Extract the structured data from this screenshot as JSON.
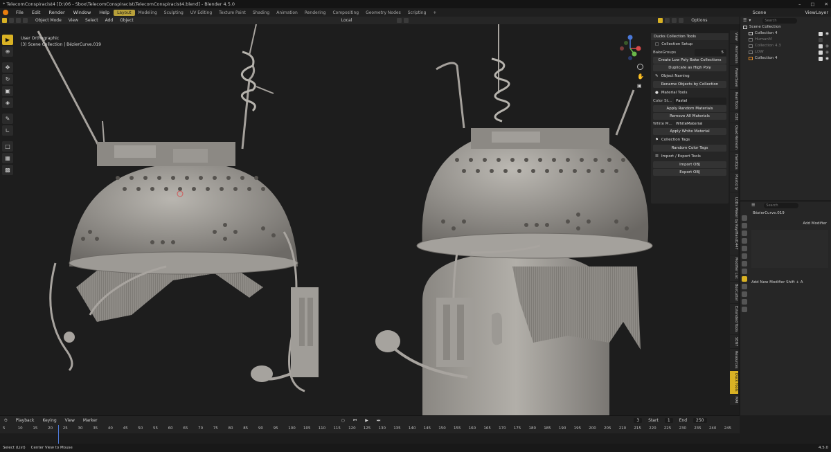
{
  "window": {
    "title": "* TelecomConspiracist4 [D:\\06 - Sbox\\TelecomConspiracist\\TelecomConspiracist4.blend] - Blender 4.5.0"
  },
  "menu": {
    "items": [
      "File",
      "Edit",
      "Render",
      "Window",
      "Help"
    ]
  },
  "workspaces": [
    "Layout",
    "Modeling",
    "Sculpting",
    "UV Editing",
    "Texture Paint",
    "Shading",
    "Animation",
    "Rendering",
    "Compositing",
    "Geometry Nodes",
    "Scripting"
  ],
  "top_right": {
    "scene": "Scene",
    "view_layer": "ViewLayer"
  },
  "viewport_header": {
    "mode": "Object Mode",
    "menus": [
      "View",
      "Select",
      "Add",
      "Object"
    ],
    "transform": "Local",
    "options": "Options"
  },
  "viewport_info": {
    "view": "User Orthographic",
    "context": "(3) Scene Collection | BézierCurve.019"
  },
  "npanel": {
    "title": "Ducks Collection Tools",
    "collection_setup": "Collection Setup",
    "bake_groups_label": "BakeGroups",
    "bake_groups_value": "5",
    "btn_create_low_poly": "Create Low Poly Bake Collections",
    "btn_duplicate": "Duplicate as High Poly",
    "object_naming": "Object Naming",
    "btn_rename": "Rename Objects by Collection",
    "material_tools": "Material Tools",
    "color_style_label": "Color St...",
    "color_style_value": "Pastel",
    "btn_apply_random": "Apply Random Materials",
    "btn_remove_all": "Remove All Materials",
    "white_mat_label": "White M...",
    "white_mat_value": "WhiteMaterial",
    "btn_apply_white": "Apply White Material",
    "collection_tags": "Collection Tags",
    "btn_random_color_tags": "Random Color Tags",
    "import_export": "Import / Export Tools",
    "btn_import_obj": "Import OBJ",
    "btn_export_obj": "Export OBJ"
  },
  "sidebar_tabs": [
    "View",
    "Animation",
    "PowerSave",
    "Real Tools",
    "Edit",
    "Quad Remesh",
    "HardOps",
    "Plasticity",
    "LODs Maker by KaylHand1447",
    "Modifier List",
    "BoxCutter",
    "Extended Tools",
    "SEN7",
    "Resources",
    "Duck Tools",
    "MAI"
  ],
  "outliner": {
    "search_placeholder": "Search",
    "scene_collection": "Scene Collection",
    "rows": [
      {
        "name": "Collection 4",
        "dim": false
      },
      {
        "name": "HumanM",
        "dim": true
      },
      {
        "name": "Collection 4.3",
        "dim": true
      },
      {
        "name": "LOW",
        "dim": true
      },
      {
        "name": "Collection 4",
        "dim": false
      }
    ]
  },
  "properties": {
    "search_placeholder": "Search",
    "object_name": "BézierCurve.019",
    "add_modifier": "Add Modifier",
    "hint": "Add New Modifier Shift + A"
  },
  "timeline": {
    "menus": [
      "Playback",
      "Keying",
      "View",
      "Marker"
    ],
    "current_frame": "3",
    "start_label": "Start",
    "start_value": "1",
    "end_label": "End",
    "end_value": "250",
    "ticks": [
      "5",
      "10",
      "15",
      "20",
      "25",
      "30",
      "35",
      "40",
      "45",
      "50",
      "55",
      "60",
      "65",
      "70",
      "75",
      "80",
      "85",
      "90",
      "95",
      "100",
      "105",
      "110",
      "115",
      "120",
      "125",
      "130",
      "135",
      "140",
      "145",
      "150",
      "155",
      "160",
      "165",
      "170",
      "175",
      "180",
      "185",
      "190",
      "195",
      "200",
      "205",
      "210",
      "215",
      "220",
      "225",
      "230",
      "235",
      "240",
      "245"
    ]
  },
  "status": {
    "select": "Select (List)",
    "center": "Center View to Mouse",
    "version": "4.5.0"
  }
}
